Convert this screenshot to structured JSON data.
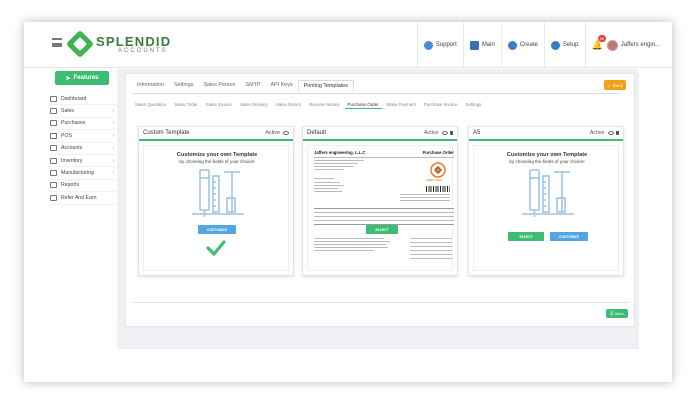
{
  "header": {
    "logo_name": "SPLENDID",
    "logo_sub": "ACCOUNTS",
    "buttons": {
      "support": "Support",
      "main": "Main",
      "create": "Create",
      "setup": "Setup"
    },
    "notification_count": "99",
    "user_name": "Jaffers engin..."
  },
  "sidebar": {
    "features_label": "Features",
    "items": [
      {
        "label": "Dashboard",
        "chevron": ""
      },
      {
        "label": "Sales",
        "chevron": "›"
      },
      {
        "label": "Purchases",
        "chevron": "›"
      },
      {
        "label": "POS",
        "chevron": "›"
      },
      {
        "label": "Accounts",
        "chevron": "›"
      },
      {
        "label": "Inventory",
        "chevron": "›"
      },
      {
        "label": "Manufacturing",
        "chevron": "›"
      },
      {
        "label": "Reports",
        "chevron": ""
      },
      {
        "label": "Refer And Earn",
        "chevron": ""
      }
    ]
  },
  "tabs": [
    "Information",
    "Settings",
    "Sales Person",
    "SMTP",
    "API Keys",
    "Printing Templates"
  ],
  "active_tab": "Printing Templates",
  "back_label": "← Back",
  "subtabs": [
    "Sales Quotation",
    "Sales Order",
    "Sales Invoice",
    "Sales Delivery",
    "Sales Return",
    "Receive Money",
    "Purchase Order",
    "Make Payment",
    "Purchase Invoice",
    "Settings"
  ],
  "active_subtab": "Purchase Order",
  "cards": {
    "custom": {
      "title": "Custom Template",
      "status": "Active",
      "heading": "Customize your own Template",
      "subheading": "by choosing the fields of your choice!",
      "customize_label": "CUSTOMIZE"
    },
    "default": {
      "title": "Default",
      "status": "Active",
      "company": "Jaffers engineering, L.L.C",
      "doc_title": "Purchase Order",
      "logo_text": "Jaffers Tower",
      "select_label": "SELECT"
    },
    "a5": {
      "title": "A5",
      "status": "Active",
      "heading": "Customize your own Template",
      "subheading": "by choosing the fields of your choice!",
      "select_label": "SELECT",
      "customize_label": "CUSTOMIZE"
    }
  },
  "save_label": "⎘ Save",
  "colors": {
    "accent_green": "#3dbc73",
    "back_orange": "#f0a21a",
    "blue": "#53a6e0",
    "illustration": "#9fc3e6"
  }
}
